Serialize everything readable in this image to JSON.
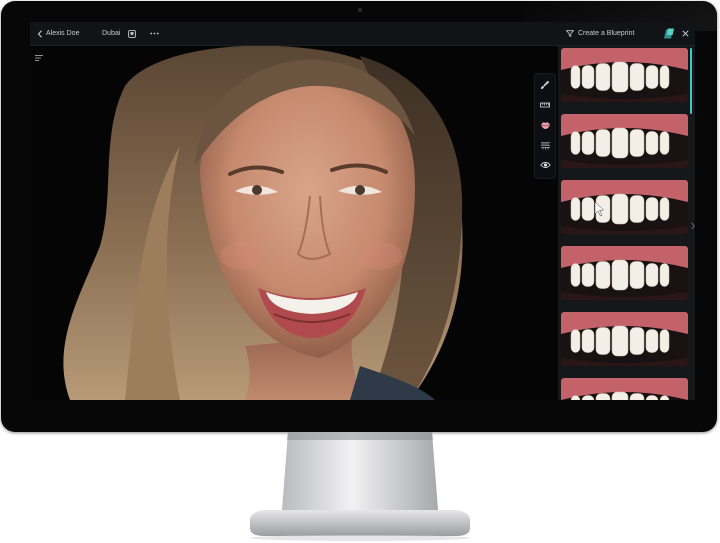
{
  "window": {
    "patient_name": "Alexis Doe",
    "location": "Dubai",
    "blueprint_label": "Create a Blueprint"
  },
  "icons": {
    "back": "chevron-left-icon",
    "tooth": "tooth-icon",
    "more": "ellipsis-icon",
    "blueprint": "funnel-icon",
    "share": "share-icon",
    "close": "close-icon",
    "filter": "sliders-icon",
    "tools": [
      "brush-icon",
      "ruler-icon",
      "lips-icon",
      "teeth-icon",
      "eye-icon"
    ]
  },
  "library": {
    "thumbnails": [
      {
        "label": "smile-option-1",
        "selected": true
      },
      {
        "label": "smile-option-2",
        "selected": false
      },
      {
        "label": "smile-option-3",
        "selected": false,
        "hover_cursor": true
      },
      {
        "label": "smile-option-4",
        "selected": false
      },
      {
        "label": "smile-option-5",
        "selected": false
      },
      {
        "label": "smile-option-6",
        "selected": false
      }
    ]
  },
  "colors": {
    "accent": "#3fc8c8",
    "bezel": "#070707",
    "topbar": "#121316",
    "panel": "#15171b"
  }
}
